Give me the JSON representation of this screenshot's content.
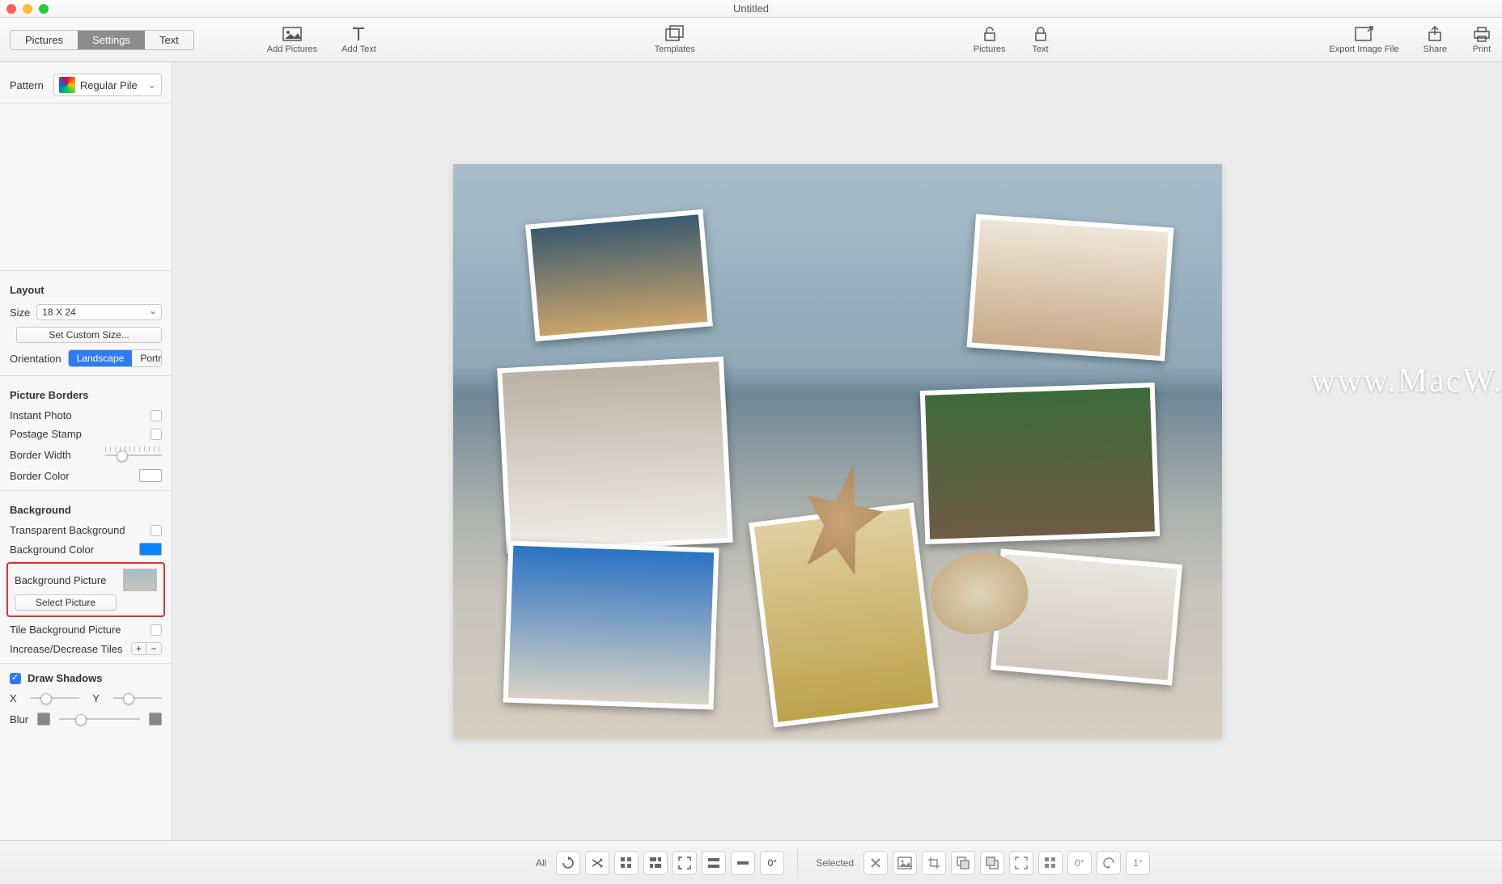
{
  "window": {
    "title": "Untitled"
  },
  "tabs": {
    "pictures": "Pictures",
    "settings": "Settings",
    "text": "Text",
    "active": "Settings"
  },
  "toolbar": {
    "addPictures": "Add Pictures",
    "addText": "Add Text",
    "templates": "Templates",
    "lockPictures": "Pictures",
    "lockText": "Text",
    "exportImage": "Export Image File",
    "share": "Share",
    "print": "Print"
  },
  "sidebar": {
    "patternLbl": "Pattern",
    "patternValue": "Regular Pile",
    "layout": {
      "heading": "Layout",
      "sizeLbl": "Size",
      "sizeValue": "18 X 24",
      "customBtn": "Set Custom Size...",
      "orientationLbl": "Orientation",
      "landscape": "Landscape",
      "portrait": "Portrait"
    },
    "borders": {
      "heading": "Picture Borders",
      "instant": "Instant Photo",
      "postage": "Postage Stamp",
      "width": "Border Width",
      "color": "Border Color"
    },
    "background": {
      "heading": "Background",
      "transparent": "Transparent Background",
      "color": "Background Color",
      "picture": "Background Picture",
      "selectBtn": "Select Picture",
      "tile": "Tile Background Picture",
      "tiles": "Increase/Decrease Tiles"
    },
    "shadows": {
      "heading": "Draw Shadows",
      "x": "X",
      "y": "Y",
      "blur": "Blur"
    }
  },
  "bottombar": {
    "all": "All",
    "zero": "0°",
    "selected": "Selected",
    "one": "1°"
  },
  "watermark": "www.MacW.com"
}
